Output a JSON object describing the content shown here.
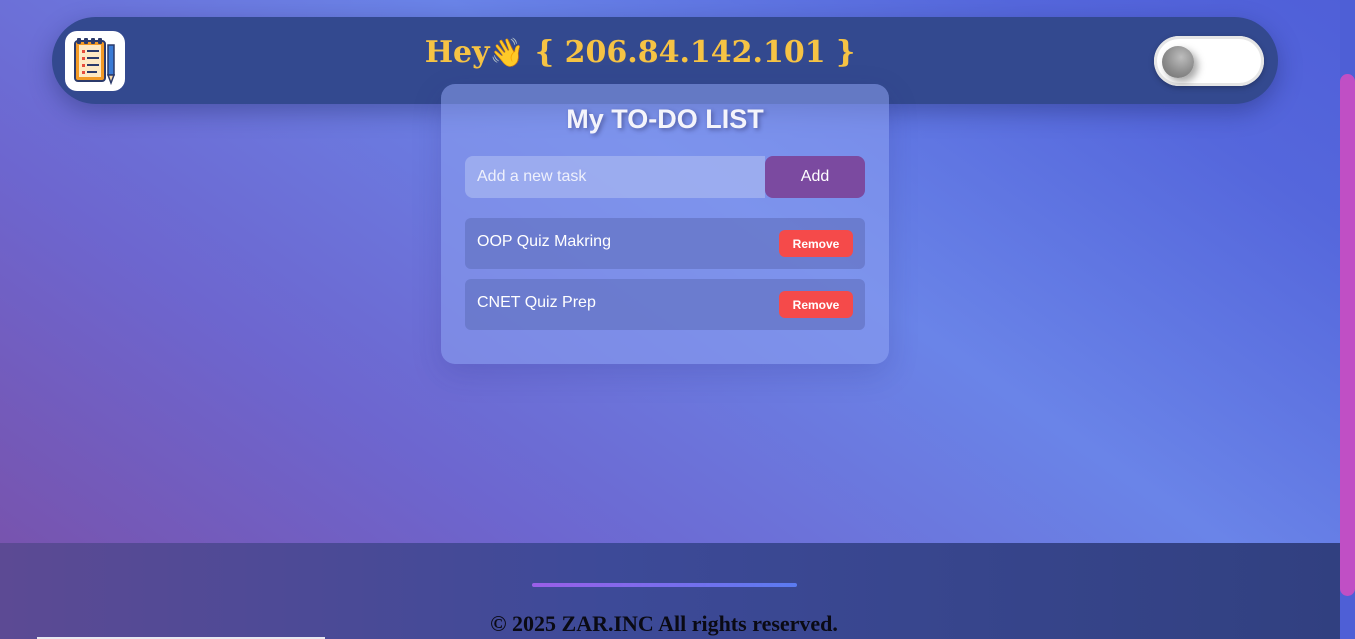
{
  "header": {
    "greeting_prefix": "Hey",
    "wave_emoji": "👋",
    "greeting_value": "{ 206.84.142.101 }",
    "logo_icon": "notepad-pencil-icon",
    "toggle_state": "off"
  },
  "todo": {
    "title": "My TO-DO LIST",
    "input_placeholder": "Add a new task",
    "input_value": "",
    "add_label": "Add",
    "tasks": [
      {
        "label": "OOP Quiz Makring",
        "remove_label": "Remove"
      },
      {
        "label": "CNET Quiz Prep",
        "remove_label": "Remove"
      }
    ]
  },
  "footer": {
    "copyright": "© 2025 ZAR.INC All rights reserved."
  },
  "colors": {
    "header_bg": "#33498f",
    "greeting": "#f6c344",
    "add_button": "#7b4aa0",
    "remove_button": "#f54a4a",
    "scroll_thumb": "#c04fc5"
  }
}
